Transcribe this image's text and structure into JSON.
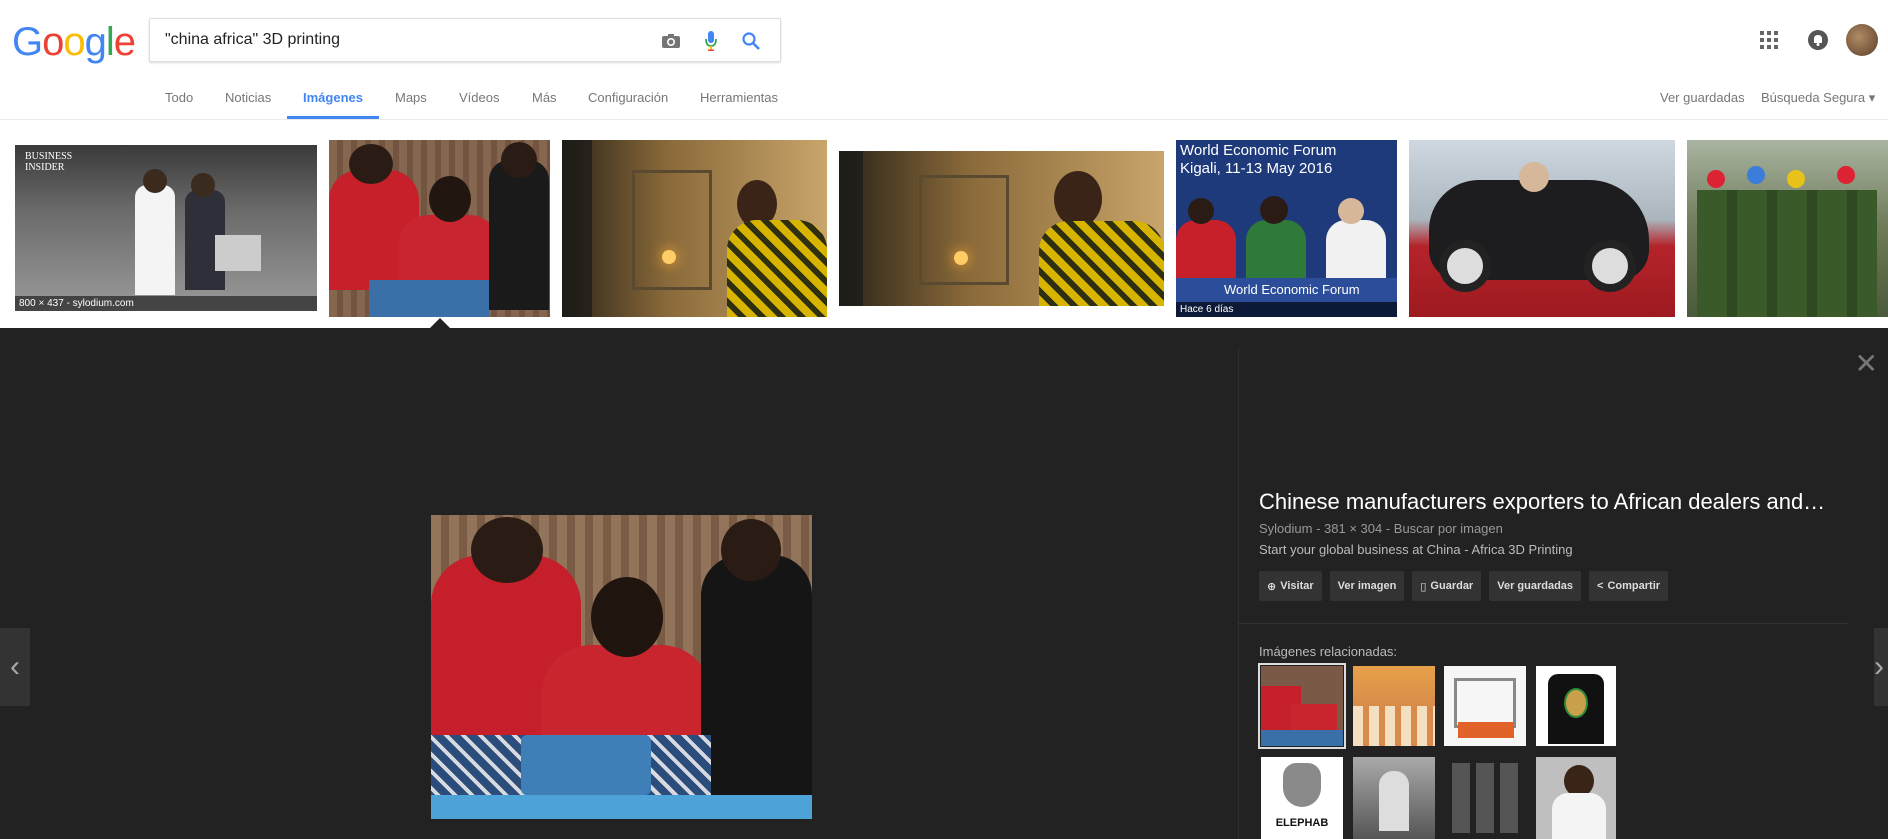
{
  "logo": {
    "letters": [
      "G",
      "o",
      "o",
      "g",
      "l",
      "e"
    ],
    "colors": [
      "#4285F4",
      "#EA4335",
      "#FBBC05",
      "#4285F4",
      "#34A853",
      "#EA4335"
    ]
  },
  "search": {
    "value": "\"china africa\" 3D printing"
  },
  "nav": {
    "items": [
      "Todo",
      "Noticias",
      "Imágenes",
      "Maps",
      "Vídeos",
      "Más",
      "Configuración",
      "Herramientas"
    ],
    "active": "Imágenes",
    "saved": "Ver guardadas",
    "safe_search": "Búsqueda Segura ▾"
  },
  "thumbs": [
    {
      "caption": "800 × 437 - sylodium.com",
      "logo_text": "BUSINESS\nINSIDER"
    },
    {
      "caption": ""
    },
    {
      "caption": ""
    },
    {
      "caption": ""
    },
    {
      "caption": "Hace 6 días",
      "banner": "World Economic Forum\nKigali, 11-13 May 2016",
      "bottom_text": "World Economic Forum"
    },
    {
      "caption": ""
    },
    {
      "caption": ""
    }
  ],
  "viewer": {
    "title": "Chinese manufacturers exporters to African dealers and…",
    "meta": "Sylodium - 381 × 304 - Buscar por imagen",
    "description": "Start your global business at China - Africa 3D Printing",
    "actions": [
      "Visitar",
      "Ver imagen",
      "Guardar",
      "Ver guardadas",
      "Compartir"
    ],
    "related_label": "Imágenes relacionadas:",
    "elephab": "ELEPHAB"
  }
}
